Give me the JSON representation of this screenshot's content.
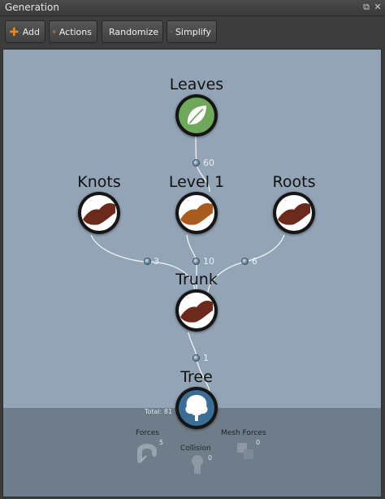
{
  "window": {
    "title": "Generation",
    "restore_glyph": "⧉",
    "close_glyph": "✕"
  },
  "toolbar": {
    "add_label": "Add",
    "actions_label": "Actions",
    "randomize_label": "Randomize",
    "simplify_label": "Simplify"
  },
  "nodes": {
    "leaves": {
      "title": "Leaves",
      "icon": "leaf-icon",
      "color": "#6fa85a"
    },
    "knots": {
      "title": "Knots",
      "icon": "branch-icon",
      "color": "#6b2a1c"
    },
    "level1": {
      "title": "Level 1",
      "icon": "branch-icon",
      "color": "#a85a1f"
    },
    "roots": {
      "title": "Roots",
      "icon": "branch-icon",
      "color": "#6b2a1c"
    },
    "trunk": {
      "title": "Trunk",
      "icon": "branch-icon",
      "color": "#6b2a1c"
    },
    "tree": {
      "title": "Tree",
      "icon": "tree-icon",
      "color": "#3c6e95",
      "total": "Total: 81"
    }
  },
  "connections": {
    "leaves_count": "60",
    "knots_count": "3",
    "level1_count": "10",
    "roots_count": "6",
    "trunk_count": "1"
  },
  "modifiers": {
    "forces": {
      "label": "Forces",
      "count": "5"
    },
    "collision": {
      "label": "Collision",
      "count": "0"
    },
    "mesh_forces": {
      "label": "Mesh Forces",
      "count": "0"
    }
  },
  "colors": {
    "canvas": "#93a4b6",
    "band": "#6f7c89",
    "wire": "#eef3f7"
  }
}
